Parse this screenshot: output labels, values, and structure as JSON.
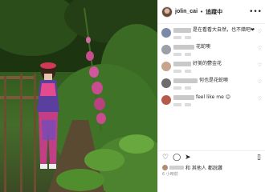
{
  "post": {
    "username": "jolin_cai",
    "separator": "•",
    "follow_label": "追蹤中",
    "more_icon": "more-horizontal-icon"
  },
  "comments": [
    {
      "text": "是在看看大自然，也不錯吧❤",
      "meta": "",
      "avatar_color": "#7a8aa8",
      "user_w": 22
    },
    {
      "text": "花蛇噢",
      "meta": "",
      "avatar_color": "#9aa0a6",
      "user_w": 26
    },
    {
      "text": "好美的鬱金花",
      "meta": "",
      "avatar_color": "#c7a48d",
      "user_w": 22
    },
    {
      "text": "何也是花蛇噢",
      "meta": "",
      "avatar_color": "#6d6d6d",
      "user_w": 30
    },
    {
      "text": "feel like me 😊",
      "meta": "",
      "avatar_color": "#b65a4a",
      "user_w": 26
    }
  ],
  "actions": {
    "like_icon": "heart-icon",
    "comment_icon": "comment-icon",
    "share_icon": "share-icon",
    "bookmark_icon": "bookmark-icon"
  },
  "likes_text": "和 其他人 都說讚",
  "time_text": "6 小時前",
  "colors": {
    "text": "#262626",
    "muted": "#8e8e8e",
    "border": "#efefef"
  }
}
